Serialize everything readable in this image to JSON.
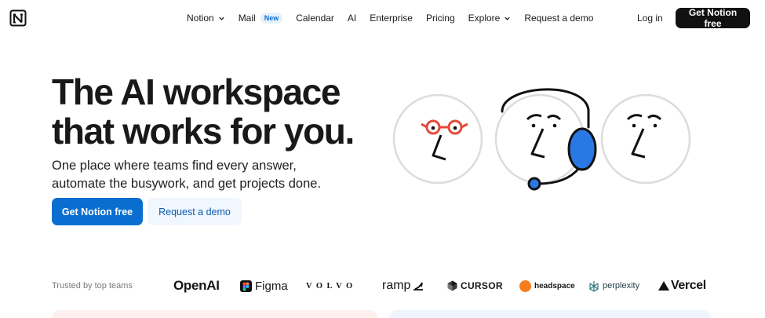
{
  "nav": {
    "items": [
      {
        "label": "Notion",
        "has_chevron": true
      },
      {
        "label": "Mail",
        "badge": "New"
      },
      {
        "label": "Calendar"
      },
      {
        "label": "AI"
      },
      {
        "label": "Enterprise"
      },
      {
        "label": "Pricing"
      },
      {
        "label": "Explore",
        "has_chevron": true
      },
      {
        "label": "Request a demo"
      }
    ],
    "login_label": "Log in",
    "cta_label": "Get Notion free"
  },
  "hero": {
    "title_line1": "The AI workspace",
    "title_line2": "that works for you.",
    "subtitle_line1": "One place where teams find every answer,",
    "subtitle_line2": "automate the busywork, and get projects done.",
    "primary_cta": "Get Notion free",
    "secondary_cta": "Request a demo"
  },
  "trusted": {
    "label": "Trusted by top teams",
    "brands": [
      "OpenAI",
      "Figma",
      "VOLVO",
      "ramp",
      "CURSOR",
      "headspace",
      "perplexity",
      "Vercel"
    ]
  },
  "colors": {
    "accent": "#0a6ed1",
    "nav_cta_bg": "#111111",
    "glasses": "#e5493a",
    "headset": "#2a78e4",
    "face_ring": "#dcdcdc"
  },
  "icons": {
    "logo": "notion-logo",
    "chevron": "chevron-down-icon"
  }
}
